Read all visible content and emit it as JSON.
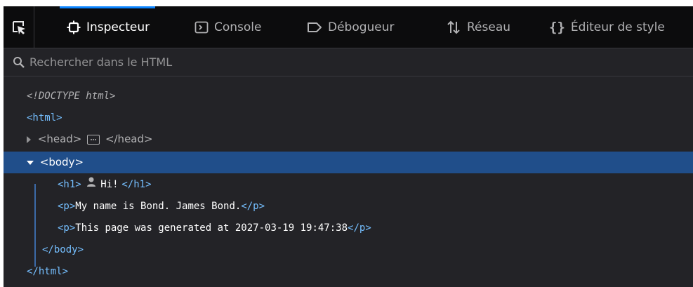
{
  "toolbar": {
    "tabs": [
      {
        "label": "Inspecteur",
        "icon": "inspector-icon",
        "active": true
      },
      {
        "label": "Console",
        "icon": "console-icon",
        "active": false
      },
      {
        "label": "Débogueur",
        "icon": "debugger-icon",
        "active": false
      },
      {
        "label": "Réseau",
        "icon": "network-icon",
        "active": false
      },
      {
        "label": "Éditeur de style",
        "icon": "style-editor-icon",
        "active": false
      }
    ]
  },
  "search": {
    "placeholder": "Rechercher dans le HTML",
    "value": ""
  },
  "tree": {
    "doctype": "<!DOCTYPE html>",
    "html_open": "<html>",
    "head_open": "<head>",
    "head_close": "</head>",
    "body_open": "<body>",
    "h1_open": "<h1>",
    "h1_text": " Hi!",
    "h1_close": "</h1>",
    "p1_open": "<p>",
    "p1_text": "My name is Bond. James Bond.",
    "p1_close": "</p>",
    "p2_open": "<p>",
    "p2_text": "This page was generated at 2027-03-19 19:47:38",
    "p2_close": "</p>",
    "body_close": "</body>",
    "html_close": "</html>"
  },
  "colors": {
    "tag": "#75bfff",
    "selection": "#204e8a",
    "active_tab_indicator": "#0a84ff",
    "panel_bg": "#232327",
    "toolbar_bg": "#0c0c0d"
  }
}
